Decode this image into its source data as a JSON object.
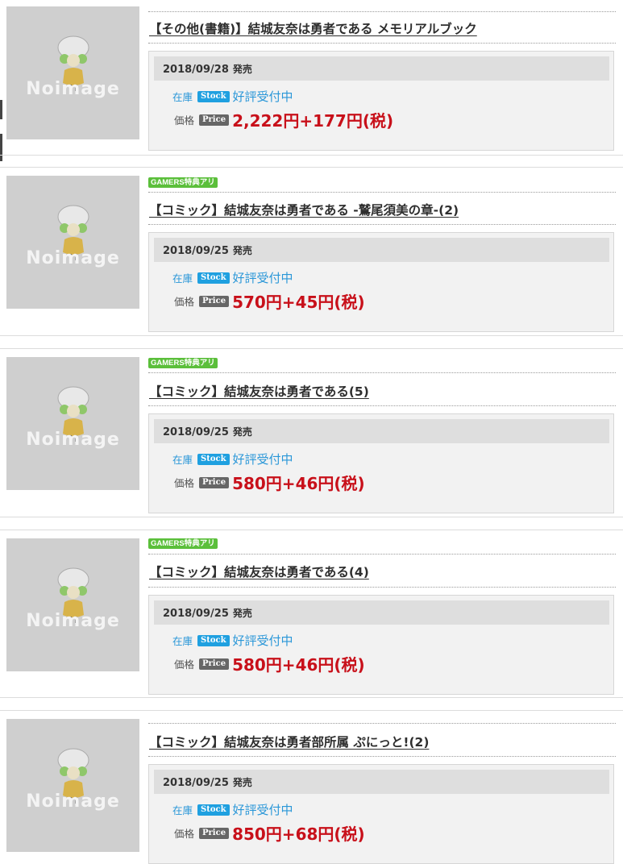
{
  "labels": {
    "no_image": "Noimage",
    "date_suffix": "発売",
    "stock_label": "在庫",
    "stock_tag": "Stock",
    "price_label": "価格",
    "price_tag": "Price"
  },
  "colors": {
    "price": "#c8101a",
    "stock": "#2a97d8",
    "badge": "#5bbf3b",
    "info_bg": "#f2f2f2",
    "date_bar": "#dedede",
    "thumb": "#cfcfcf"
  },
  "products": [
    {
      "badge": "",
      "title": "【その他(書籍)】結城友奈は勇者である メモリアルブック",
      "date": "2018/09/28",
      "stock_status": "好評受付中",
      "price": "2,222円+177円(税)"
    },
    {
      "badge": "GAMERS特典アリ",
      "title": "【コミック】結城友奈は勇者である -鷲尾須美の章-(2)",
      "date": "2018/09/25",
      "stock_status": "好評受付中",
      "price": "570円+45円(税)"
    },
    {
      "badge": "GAMERS特典アリ",
      "title": "【コミック】結城友奈は勇者である(5)",
      "date": "2018/09/25",
      "stock_status": "好評受付中",
      "price": "580円+46円(税)"
    },
    {
      "badge": "GAMERS特典アリ",
      "title": "【コミック】結城友奈は勇者である(4)",
      "date": "2018/09/25",
      "stock_status": "好評受付中",
      "price": "580円+46円(税)"
    },
    {
      "badge": "",
      "title": "【コミック】結城友奈は勇者部所属 ぷにっと!(2)",
      "date": "2018/09/25",
      "stock_status": "好評受付中",
      "price": "850円+68円(税)"
    }
  ]
}
